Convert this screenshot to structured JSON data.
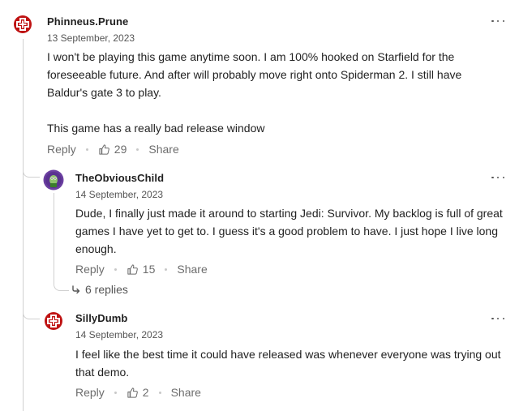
{
  "comments": [
    {
      "author": "Phinneus.Prune",
      "date": "13 September, 2023",
      "body": [
        "I won't be playing this game anytime soon. I am 100% hooked on Starfield for the foreseeable future. And after will probably move right onto Spiderman 2. I still have Baldur's gate 3 to play.",
        "This game has a really bad release window"
      ],
      "reply_label": "Reply",
      "likes": "29",
      "share_label": "Share",
      "avatar_icon": "ign-logo-icon"
    },
    {
      "author": "TheObviousChild",
      "date": "14 September, 2023",
      "body": [
        "Dude, I finally just made it around to starting Jedi: Survivor.  My backlog is full of great games I have yet to get to.  I guess it's a good problem to have.  I just hope I live long enough."
      ],
      "reply_label": "Reply",
      "likes": "15",
      "share_label": "Share",
      "replies_link": "6 replies",
      "avatar_icon": "character-avatar-icon"
    },
    {
      "author": "SillyDumb",
      "date": "14 September, 2023",
      "body": [
        "I feel like the best time it could have released was whenever everyone was trying out that demo."
      ],
      "reply_label": "Reply",
      "likes": "2",
      "share_label": "Share",
      "avatar_icon": "ign-logo-icon"
    }
  ],
  "icons": {
    "more": "more-options-icon",
    "like": "thumbs-up-icon",
    "reply_arrow": "reply-arrow-icon"
  },
  "colors": {
    "ign_red": "#bf1313",
    "avatar_purple": "#6b3fa0",
    "text": "#222222",
    "muted": "#6d6d6d"
  }
}
